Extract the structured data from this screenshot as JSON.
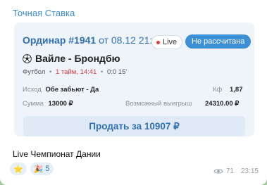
{
  "channel": {
    "name": "Точная Ставка"
  },
  "order": {
    "number": "Ординар #1941",
    "date": "от 08.12 21:15",
    "live_badge": "Live",
    "status_badge": "Не рассчитана",
    "match": "Вайле - Брондбю",
    "sport": "Футбол",
    "time": "1 тайм, 14:41",
    "score": "0:0 15'",
    "outcome_label": "Исход",
    "outcome_value": "Обе забьют - Да",
    "coef_label": "Кф",
    "coef_value": "1,87",
    "sum_label": "Сумма",
    "sum_value": "13000 ₽",
    "win_label": "Возможный выигрыш",
    "win_value": "24310.00 ₽",
    "sell_label": "Продать за 10907 ₽"
  },
  "caption": "Live Чемпионат Дании",
  "reactions": [
    {
      "icon": "star-icon",
      "emoji": "⭐",
      "count": ""
    },
    {
      "icon": "party-popper-icon",
      "emoji": "🎉",
      "count": "5"
    }
  ],
  "footer": {
    "views": "71",
    "time": "23:15"
  },
  "colors": {
    "accent": "#2f6fb2",
    "status_badge": "#3d8fd6",
    "live_dot": "#e33b3b",
    "time_red": "#d03b3b"
  }
}
